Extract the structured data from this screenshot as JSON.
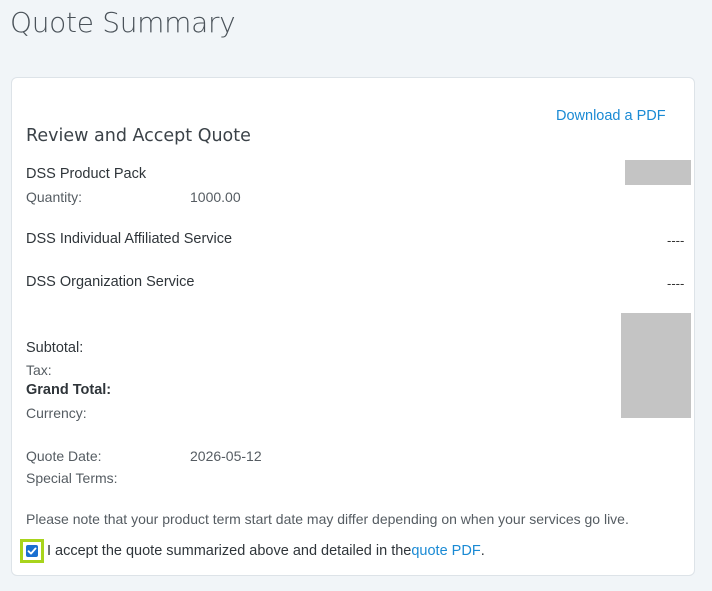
{
  "page": {
    "title": "Quote Summary"
  },
  "card": {
    "download_label": "Download a PDF",
    "heading": "Review and Accept Quote",
    "items": [
      {
        "name": "DSS Product Pack",
        "quantity_label": "Quantity:",
        "quantity_value": "1000.00"
      },
      {
        "name": "DSS Individual Affiliated Service",
        "value": "----"
      },
      {
        "name": "DSS Organization Service",
        "value": "----"
      }
    ],
    "totals": {
      "subtotal_label": "Subtotal:",
      "tax_label": "Tax:",
      "grand_total_label": "Grand Total:",
      "currency_label": "Currency:"
    },
    "meta": {
      "quote_date_label": "Quote Date:",
      "quote_date_value": "2026-05-12",
      "special_terms_label": "Special Terms:"
    },
    "note": "Please note that your product term start date may differ depending on when your services go live.",
    "accept": {
      "checked": true,
      "text_before": "I accept the quote summarized above and detailed in the ",
      "link_text": "quote PDF",
      "text_after": "."
    }
  },
  "colors": {
    "link": "#1a8ad4",
    "checkbox_highlight": "#a8d41c",
    "checkbox_fill": "#1a6fd1",
    "redaction": "#c4c4c4"
  }
}
